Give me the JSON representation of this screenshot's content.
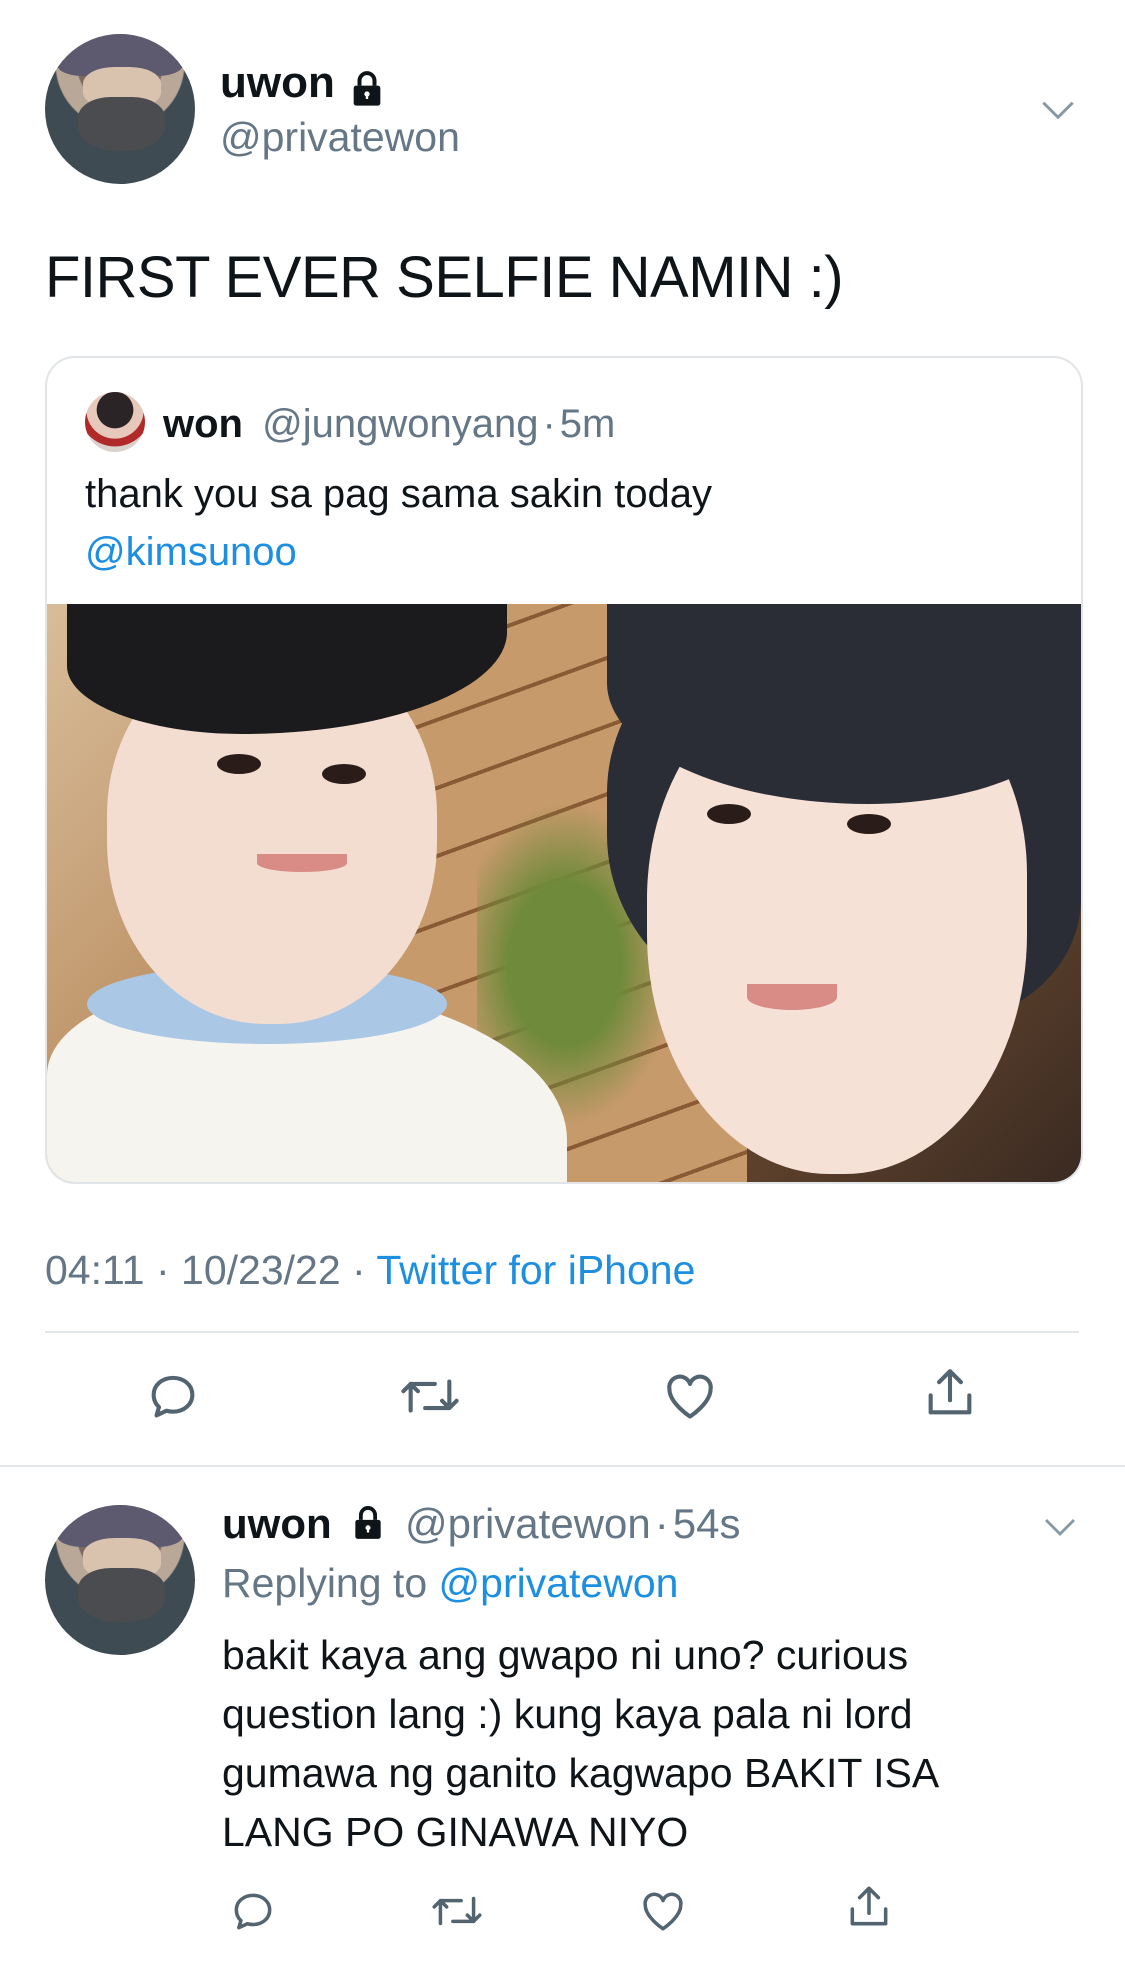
{
  "main_tweet": {
    "display_name": "uwon",
    "handle": "@privatewon",
    "text": "FIRST EVER SELFIE NAMIN :)",
    "meta_time": "04:11",
    "meta_date": "10/23/22",
    "meta_source": "Twitter for iPhone",
    "separator": "·"
  },
  "quoted_tweet": {
    "display_name": "won",
    "handle": "@jungwonyang",
    "time": "5m",
    "separator": "·",
    "text": "thank you sa pag sama sakin today",
    "mention": "@kimsunoo"
  },
  "reply": {
    "display_name": "uwon",
    "handle": "@privatewon",
    "time": "54s",
    "separator": "·",
    "replying_prefix": "Replying to",
    "replying_handle": "@privatewon",
    "text_lines": [
      "bakit kaya ang gwapo ni uno? curious",
      "question lang :) kung kaya pala ni lord",
      "gumawa ng ganito kagwapo BAKIT ISA",
      "LANG PO GINAWA NIYO"
    ]
  },
  "icons": [
    "lock-icon",
    "chevron-down-icon",
    "reply-icon",
    "retweet-icon",
    "like-icon",
    "share-icon"
  ],
  "colors": {
    "link": "#1d8fe0",
    "muted": "#657786",
    "text": "#0f1419",
    "divider": "#e3e6e8"
  }
}
